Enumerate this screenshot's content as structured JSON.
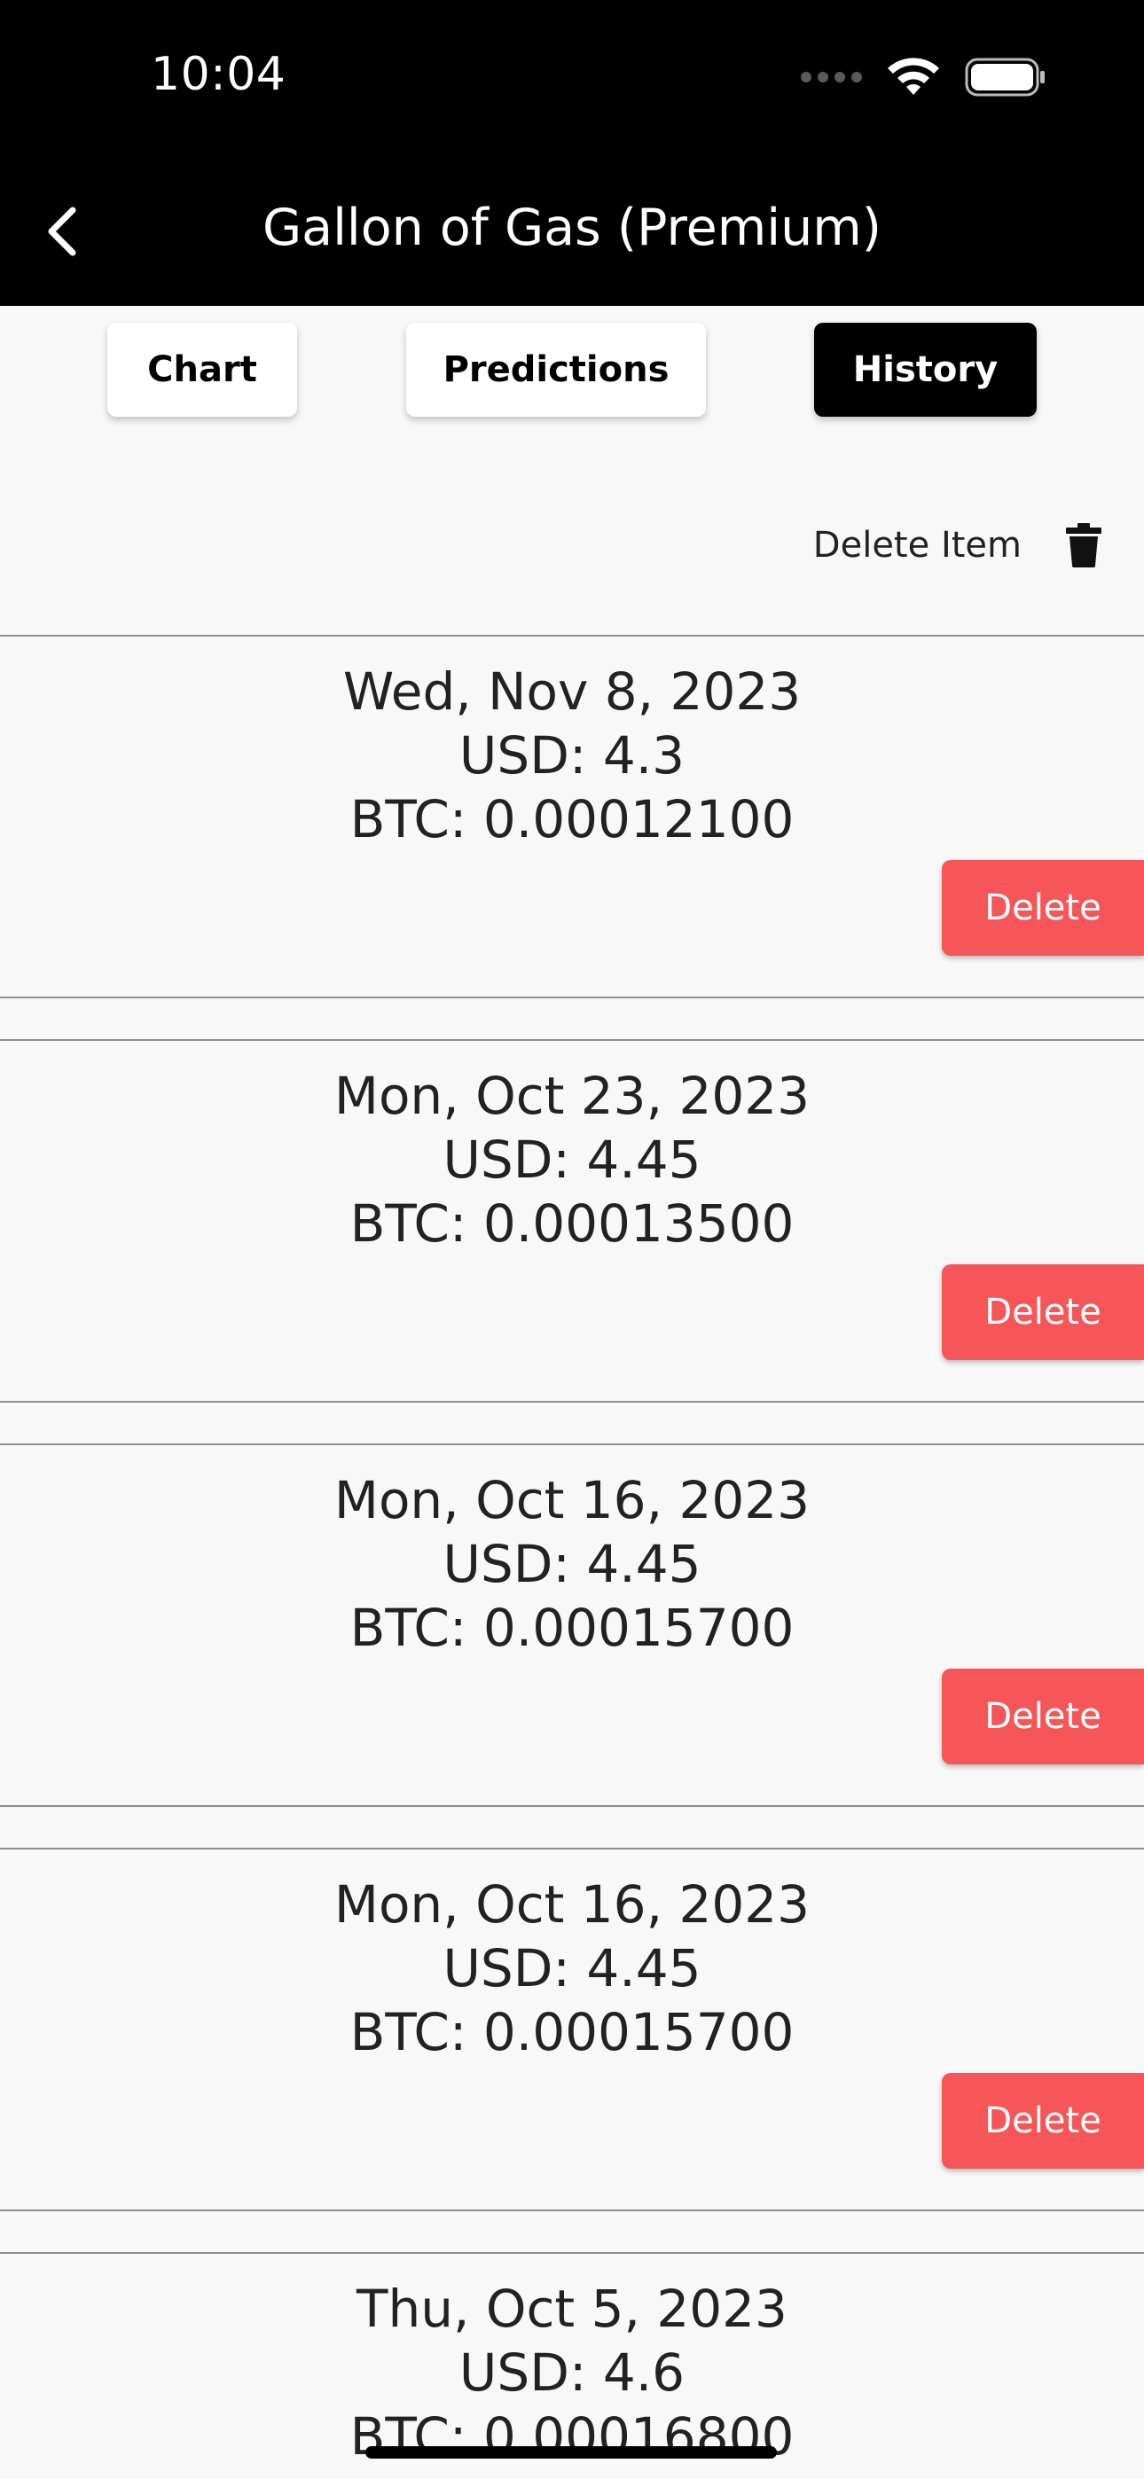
{
  "status_bar": {
    "time": "10:04"
  },
  "nav": {
    "title": "Gallon of Gas (Premium)"
  },
  "tabs": [
    {
      "label": "Chart",
      "active": false
    },
    {
      "label": "Predictions",
      "active": false
    },
    {
      "label": "History",
      "active": true
    }
  ],
  "actions": {
    "delete_item_label": "Delete Item"
  },
  "colors": {
    "delete_button": "#f65658",
    "header": "#000000",
    "background": "#f8f8f8"
  },
  "history": [
    {
      "date": "Wed, Nov 8, 2023",
      "usd": "USD: 4.3",
      "btc": "BTC: 0.00012100",
      "delete_label": "Delete"
    },
    {
      "date": "Mon, Oct 23, 2023",
      "usd": "USD: 4.45",
      "btc": "BTC: 0.00013500",
      "delete_label": "Delete"
    },
    {
      "date": "Mon, Oct 16, 2023",
      "usd": "USD: 4.45",
      "btc": "BTC: 0.00015700",
      "delete_label": "Delete"
    },
    {
      "date": "Mon, Oct 16, 2023",
      "usd": "USD: 4.45",
      "btc": "BTC: 0.00015700",
      "delete_label": "Delete"
    },
    {
      "date": "Thu, Oct 5, 2023",
      "usd": "USD: 4.6",
      "btc": "BTC: 0.00016800"
    }
  ]
}
